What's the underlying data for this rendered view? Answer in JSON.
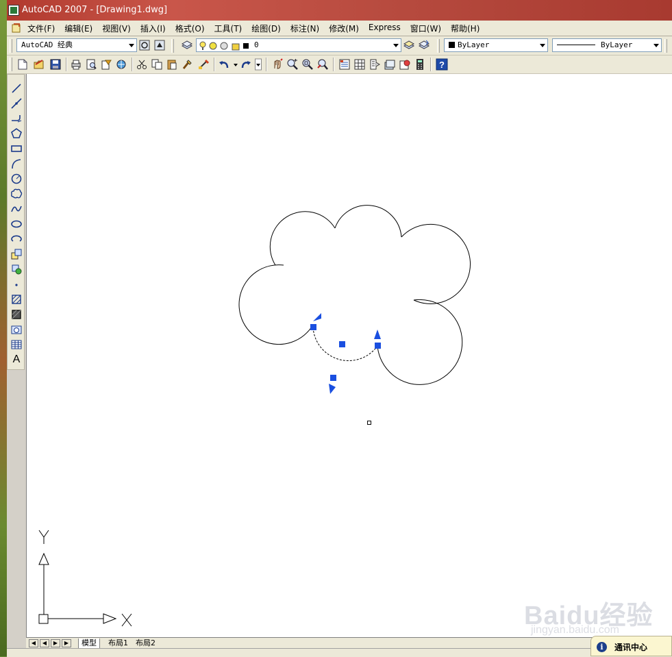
{
  "window": {
    "title": "AutoCAD 2007 - [Drawing1.dwg]"
  },
  "menu": {
    "items": [
      "文件(F)",
      "编辑(E)",
      "视图(V)",
      "插入(I)",
      "格式(O)",
      "工具(T)",
      "绘图(D)",
      "标注(N)",
      "修改(M)",
      "Express",
      "窗口(W)",
      "帮助(H)"
    ]
  },
  "toolbar": {
    "workspace": "AutoCAD 经典",
    "layer": "0",
    "color": "ByLayer",
    "linetype": "ByLayer"
  },
  "drawing": {
    "ucs_x": "X",
    "ucs_y": "Y",
    "accent_grip_color": "#1a4fe0",
    "line_color": "#000000"
  },
  "layout_tabs": [
    "模型",
    "布局1",
    "布局2"
  ],
  "comm_center": {
    "label": "通讯中心"
  },
  "watermark": {
    "brand": "Baidu经验",
    "url": "jingyan.baidu.com"
  }
}
